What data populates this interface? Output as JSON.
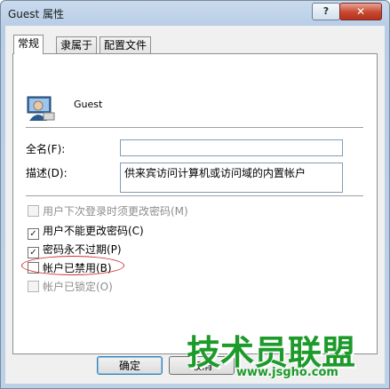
{
  "window": {
    "title": "Guest 属性",
    "help_label": "?",
    "close_label": "✕"
  },
  "tabs": [
    {
      "label": "常规",
      "active": true
    },
    {
      "label": "隶属于",
      "active": false
    },
    {
      "label": "配置文件",
      "active": false
    }
  ],
  "user": {
    "name": "Guest",
    "icon": "users-icon"
  },
  "fields": {
    "fullname_label": "全名(F):",
    "fullname_value": "",
    "desc_label": "描述(D):",
    "desc_value": "供来宾访问计算机或访问域的内置帐户"
  },
  "checkboxes": [
    {
      "label": "用户下次登录时须更改密码(M)",
      "checked": false,
      "enabled": false
    },
    {
      "label": "用户不能更改密码(C)",
      "checked": true,
      "enabled": true
    },
    {
      "label": "密码永不过期(P)",
      "checked": true,
      "enabled": true
    },
    {
      "label": "帐户已禁用(B)",
      "checked": false,
      "enabled": true
    },
    {
      "label": "帐户已锁定(O)",
      "checked": false,
      "enabled": false
    }
  ],
  "buttons": {
    "ok": "确定",
    "cancel": "取消"
  },
  "watermark": {
    "text": "技术员联盟",
    "url": "www.jsgho.com"
  },
  "colors": {
    "highlight_oval": "#d03030",
    "watermark": "#1c9a2a"
  }
}
